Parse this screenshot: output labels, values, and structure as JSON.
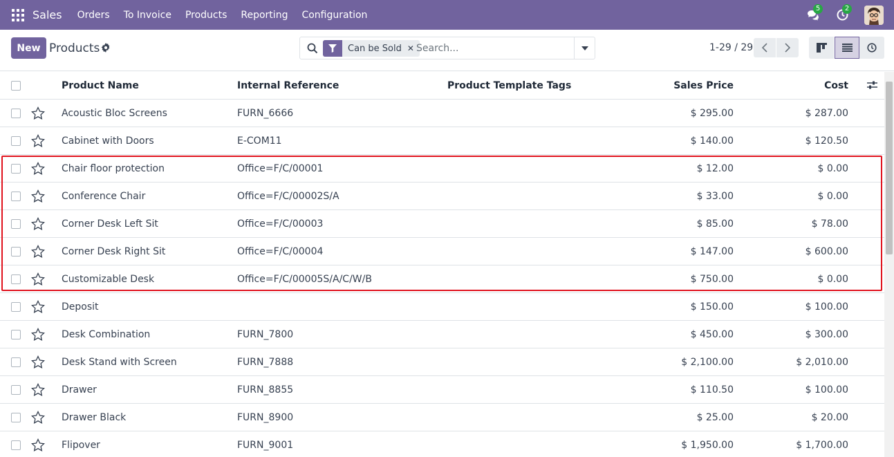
{
  "navbar": {
    "brand": "Sales",
    "menu": [
      "Orders",
      "To Invoice",
      "Products",
      "Reporting",
      "Configuration"
    ],
    "messages_count": "5",
    "activities_count": "2"
  },
  "control": {
    "new_label": "New",
    "title": "Products",
    "facet_label": "Can be Sold",
    "search_placeholder": "Search...",
    "pager": "1-29 / 29"
  },
  "table": {
    "headers": {
      "name": "Product Name",
      "ref": "Internal Reference",
      "tags": "Product Template Tags",
      "price": "Sales Price",
      "cost": "Cost"
    },
    "rows": [
      {
        "name": "Acoustic Bloc Screens",
        "ref": "FURN_6666",
        "tags": "",
        "price": "$ 295.00",
        "cost": "$ 287.00"
      },
      {
        "name": "Cabinet with Doors",
        "ref": "E-COM11",
        "tags": "",
        "price": "$ 140.00",
        "cost": "$ 120.50"
      },
      {
        "name": "Chair floor protection",
        "ref": "Office=F/C/00001",
        "tags": "",
        "price": "$ 12.00",
        "cost": "$ 0.00"
      },
      {
        "name": "Conference Chair",
        "ref": "Office=F/C/00002S/A",
        "tags": "",
        "price": "$ 33.00",
        "cost": "$ 0.00"
      },
      {
        "name": "Corner Desk Left Sit",
        "ref": "Office=F/C/00003",
        "tags": "",
        "price": "$ 85.00",
        "cost": "$ 78.00"
      },
      {
        "name": "Corner Desk Right Sit",
        "ref": "Office=F/C/00004",
        "tags": "",
        "price": "$ 147.00",
        "cost": "$ 600.00"
      },
      {
        "name": "Customizable Desk",
        "ref": "Office=F/C/00005S/A/C/W/B",
        "tags": "",
        "price": "$ 750.00",
        "cost": "$ 0.00"
      },
      {
        "name": "Deposit",
        "ref": "",
        "tags": "",
        "price": "$ 150.00",
        "cost": "$ 100.00"
      },
      {
        "name": "Desk Combination",
        "ref": "FURN_7800",
        "tags": "",
        "price": "$ 450.00",
        "cost": "$ 300.00"
      },
      {
        "name": "Desk Stand with Screen",
        "ref": "FURN_7888",
        "tags": "",
        "price": "$ 2,100.00",
        "cost": "$ 2,010.00"
      },
      {
        "name": "Drawer",
        "ref": "FURN_8855",
        "tags": "",
        "price": "$ 110.50",
        "cost": "$ 100.00"
      },
      {
        "name": "Drawer Black",
        "ref": "FURN_8900",
        "tags": "",
        "price": "$ 25.00",
        "cost": "$ 20.00"
      },
      {
        "name": "Flipover",
        "ref": "FURN_9001",
        "tags": "",
        "price": "$ 1,950.00",
        "cost": "$ 1,700.00"
      }
    ]
  },
  "colors": {
    "brand": "#71639e",
    "highlight": "#e0121d",
    "badge": "#28a745"
  }
}
